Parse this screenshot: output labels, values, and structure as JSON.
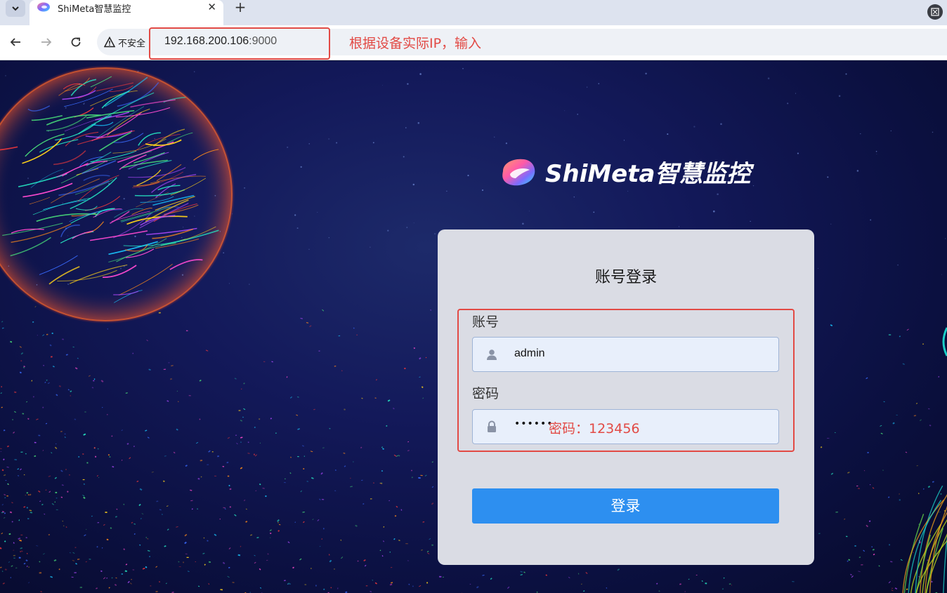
{
  "browser": {
    "tab_title": "ShiMeta智慧监控",
    "tab_close": "✕",
    "new_tab": "+",
    "security_label": "不安全",
    "url_host": "192.168.200.106",
    "url_port": ":9000"
  },
  "annotations": {
    "url_note": "根据设备实际IP，输入",
    "password_note": "密码：123456",
    "color": "#e24a45"
  },
  "brand": {
    "name": "ShiMeta智慧监控"
  },
  "login": {
    "title": "账号登录",
    "username_label": "账号",
    "username_value": "admin",
    "password_label": "密码",
    "password_mask": "••••••",
    "submit_label": "登录",
    "button_color": "#2d8ff0"
  },
  "icons": {
    "tab_list": "chevron-down-icon",
    "back": "arrow-left-icon",
    "forward": "arrow-right-icon",
    "reload": "reload-icon",
    "warning": "warning-icon",
    "user": "user-icon",
    "lock": "lock-icon"
  }
}
